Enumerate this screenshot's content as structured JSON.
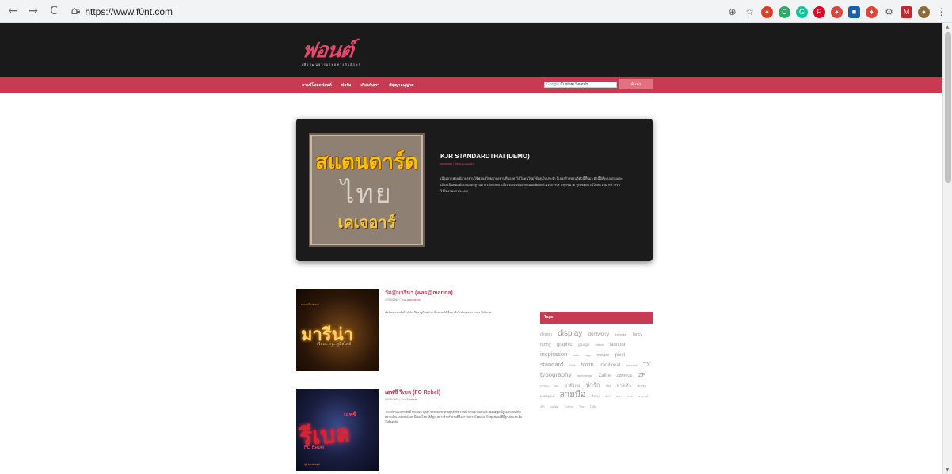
{
  "browser": {
    "url": "https://www.f0nt.com",
    "nav": {
      "back": "←",
      "forward": "→",
      "reload": "C",
      "home": "⌂"
    },
    "extensions": [
      {
        "name": "zoom-icon",
        "glyph": "⊕",
        "color": "transparent",
        "kind": "plain"
      },
      {
        "name": "star-icon",
        "glyph": "☆",
        "color": "transparent",
        "kind": "plain"
      },
      {
        "name": "ext-red-icon",
        "glyph": "●",
        "color": "#e23c2a",
        "kind": "round"
      },
      {
        "name": "ext-green-c-icon",
        "glyph": "C",
        "color": "#2fa96a",
        "kind": "round"
      },
      {
        "name": "ext-grammarly-icon",
        "glyph": "G",
        "color": "#15c39a",
        "kind": "round"
      },
      {
        "name": "ext-pinterest-icon",
        "glyph": "P",
        "color": "#e60023",
        "kind": "round"
      },
      {
        "name": "ext-red-badge-icon",
        "glyph": "●",
        "color": "#d9463b",
        "kind": "round"
      },
      {
        "name": "ext-blue-square-icon",
        "glyph": "■",
        "color": "#1a5fb4",
        "kind": "sq"
      },
      {
        "name": "ext-shield-icon",
        "glyph": "♦",
        "color": "#e0453a",
        "kind": "round"
      },
      {
        "name": "ext-gear-icon",
        "glyph": "⚙",
        "color": "transparent",
        "kind": "plain"
      },
      {
        "name": "ext-red-square-icon",
        "glyph": "M",
        "color": "#c2262e",
        "kind": "sq"
      },
      {
        "name": "ext-avatar-icon",
        "glyph": "●",
        "color": "#8b6a3e",
        "kind": "round"
      },
      {
        "name": "menu-icon",
        "glyph": "⋮",
        "color": "transparent",
        "kind": "plain"
      }
    ]
  },
  "site": {
    "logo": "ฟอนต์",
    "tagline": "เพื่อวัฒนธรรมไทยทางตัวอักษร",
    "menu": [
      "ดาวน์โหลดฟอนต์",
      "ฟอร์ม",
      "เกี่ยวกับเรา",
      "สัญญาอนุญาต"
    ],
    "search": {
      "google": "Google",
      "placeholder": "Custom Search",
      "button": "ค้นหา"
    }
  },
  "hero": {
    "thumb_lines": [
      "สแตนดาร์ด",
      "ไทย",
      "เคเจอาร์"
    ],
    "title": "KJR STANDARDTHAI (DEMO)",
    "meta": "24/09/2562 | โดย kjrstandardthai",
    "description": "เนื่องจากฟอนต์มาตรฐานใช้ฟอนต์ไทยมาตรฐานที่มองหาได้ในคนไทยใช้อยู่เป็นประจำ ก็เลยสร้างฟอนต์ตัวนี้ขึ้นมา ตัวนี้มีทั้งแบบตรงและเอียง เป็นฟอนต์แบบมาตรฐานอักษรมีหางปลาเลื่อนรองรับตัวอักษรแบบพิเศษเกินจากระเพาะทุกขนาด ทุกเขตดาวน์โหลด เหมาะสำหรับใช้ในงานทุกประเภท"
  },
  "posts": [
    {
      "title": "วัส@มารีน่า (was@marina)",
      "date": "17/09/2562",
      "by": "โดย",
      "author": "wasmarina",
      "excerpt": "ตัวอักษรแนวคุ้ยโมเดิร์น มีบักอยู่นิดหน่อย ถ้าอยากได้เต็มๆ เข้าไปทักเพจกัน ราคา 300 บาท",
      "thumb": {
        "big": "มารีน่า",
        "small": "เรียบ...หรู...ดูมีสไตล์",
        "tiny": "คอมมะรีนาฟอนต์"
      }
    },
    {
      "title": "เอฟซี รีเบล (FC Rebel)",
      "date": "08/09/2562",
      "by": "โดย",
      "author": "Fontcraft",
      "excerpt": "\"ตัวอักษรแนวเกรฟฟิตี้ ขีดเขียน บุคลิก ทรงพลัง ท้าทายทุกสิ่งที่ขวางหน้าด้วยความมั่นใจ\" ฟอนต์ชุดนี้ถูกออกแบบให้มีความเป็นเอกลักษณ์ และมีเพอร์โซนาลิตี้สูง เหมาะสำหรับงานที่ต้องการความโดดเด่น เป็นชุดฟอนต์ที่มีลูกเล่นและเต็มไปด้วยพลัง",
      "thumb": {
        "big": "รีเบล",
        "fc": "เอฟซี",
        "rebel": "FC Rebel",
        "brand": "@ fontcraft"
      }
    }
  ],
  "tags": {
    "title": "Tags",
    "items": [
      {
        "t": "design",
        "s": 5
      },
      {
        "t": "display",
        "s": 10
      },
      {
        "t": "dontworry",
        "s": 6
      },
      {
        "t": "exhibition",
        "s": 3.5
      },
      {
        "t": "fancy",
        "s": 5
      },
      {
        "t": "funny",
        "s": 5.5
      },
      {
        "t": "graphic",
        "s": 6
      },
      {
        "t": "grunge",
        "s": 4.5
      },
      {
        "t": "hitech",
        "s": 4
      },
      {
        "t": "iannnnn",
        "s": 6
      },
      {
        "t": "inspiration",
        "s": 7.5
      },
      {
        "t": "latin",
        "s": 4
      },
      {
        "t": "logo",
        "s": 4
      },
      {
        "t": "movies",
        "s": 5
      },
      {
        "t": "pixel",
        "s": 6
      },
      {
        "t": "standard",
        "s": 7.5
      },
      {
        "t": "Thai",
        "s": 4
      },
      {
        "t": "toxin",
        "s": 7.5
      },
      {
        "t": "traditional",
        "s": 6
      },
      {
        "t": "tutorials",
        "s": 4
      },
      {
        "t": "TX",
        "s": 7
      },
      {
        "t": "typography",
        "s": 8
      },
      {
        "t": "webdesign",
        "s": 4
      },
      {
        "t": "Zafire",
        "s": 6
      },
      {
        "t": "Zafire06",
        "s": 5.5
      },
      {
        "t": "ZF",
        "s": 7
      },
      {
        "t": "การ์ตูน",
        "s": 3.5
      },
      {
        "t": "คม",
        "s": 3.5
      },
      {
        "t": "ชาติไทย",
        "s": 5.5
      },
      {
        "t": "น่ารัก",
        "s": 7.5
      },
      {
        "t": "ป่น",
        "s": 4.5
      },
      {
        "t": "พาดหัว",
        "s": 6
      },
      {
        "t": "พิกเซล",
        "s": 4
      },
      {
        "t": "มาตรฐาน",
        "s": 4
      },
      {
        "t": "ลายมือ",
        "s": 11
      },
      {
        "t": "ลีลาบุ",
        "s": 4
      },
      {
        "t": "สัตว์",
        "s": 3.5
      },
      {
        "t": "หนา",
        "s": 3.5
      },
      {
        "t": "หวัด",
        "s": 3.5
      },
      {
        "t": "อาจารย์",
        "s": 3.5
      },
      {
        "t": "เด็ก",
        "s": 3.5
      },
      {
        "t": "เหลี่ยม",
        "s": 3.5
      },
      {
        "t": "โบราณ",
        "s": 3.5
      },
      {
        "t": "โกย",
        "s": 3.5
      },
      {
        "t": "โกมิน",
        "s": 3.5
      }
    ]
  }
}
